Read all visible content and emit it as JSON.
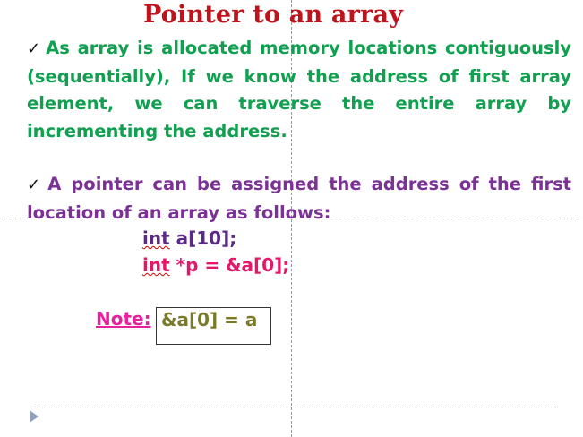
{
  "slide": {
    "title": "Pointer to an array",
    "bullets": [
      {
        "check": "✓",
        "text": "As array is allocated memory locations contiguously (sequentially), If we know the address of first array element, we can traverse the entire array by incrementing the address."
      },
      {
        "check": "✓",
        "text": "A pointer can be assigned the address of the first location of an array as follows:"
      }
    ],
    "code": [
      {
        "keyword": "int",
        "rest": " a[10];"
      },
      {
        "keyword": "int",
        "rest": " *p = &a[0];"
      }
    ],
    "note": {
      "label": "Note:",
      "value": "&a[0] = a"
    }
  },
  "icons": {
    "advance": "play-triangle-icon"
  },
  "colors": {
    "title": "#c0141c",
    "bullet1": "#10a050",
    "bullet2": "#7b3295",
    "code1": "#5b2a86",
    "code2": "#e6176b",
    "note_label": "#e8219e",
    "note_value": "#7a7a2a"
  }
}
